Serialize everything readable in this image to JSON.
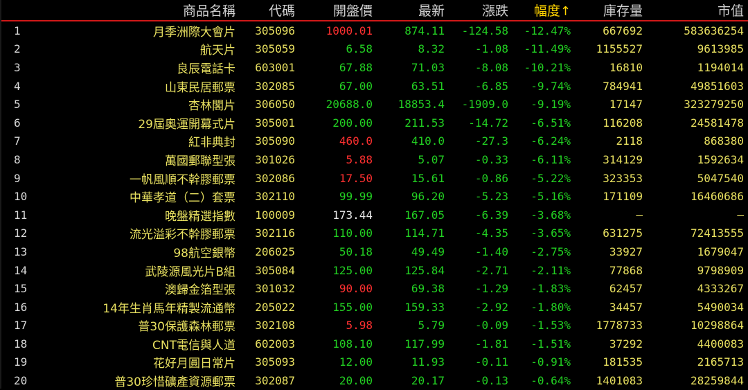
{
  "columns": {
    "name": "商品名稱",
    "code": "代碼",
    "open": "開盤價",
    "last": "最新",
    "change": "漲跌",
    "pct": "幅度",
    "stock": "庫存量",
    "cap": "市值"
  },
  "sort_arrow": "↑",
  "colors": {
    "up": "#ff3030",
    "down": "#22d022",
    "flat": "#e8e8e8",
    "label": "#e8e060",
    "header_line": "#d01818"
  },
  "rows": [
    {
      "idx": "1",
      "name": "月季洲際大會片",
      "code": "305096",
      "open": "1000.01",
      "open_color": "red",
      "last": "874.11",
      "change": "-124.58",
      "pct": "-12.47%",
      "stock": "667692",
      "cap": "583636254"
    },
    {
      "idx": "2",
      "name": "航天片",
      "code": "305059",
      "open": "6.58",
      "open_color": "green",
      "last": "8.32",
      "change": "-1.08",
      "pct": "-11.49%",
      "stock": "1155527",
      "cap": "9613985"
    },
    {
      "idx": "3",
      "name": "良辰電話卡",
      "code": "603001",
      "open": "67.88",
      "open_color": "green",
      "last": "71.03",
      "change": "-8.08",
      "pct": "-10.21%",
      "stock": "16810",
      "cap": "1194014"
    },
    {
      "idx": "4",
      "name": "山東民居郵票",
      "code": "302085",
      "open": "67.00",
      "open_color": "green",
      "last": "63.51",
      "change": "-6.85",
      "pct": "-9.74%",
      "stock": "784941",
      "cap": "49851603"
    },
    {
      "idx": "5",
      "name": "杏林閣片",
      "code": "306050",
      "open": "20688.0",
      "open_color": "green",
      "last": "18853.4",
      "change": "-1909.0",
      "pct": "-9.19%",
      "stock": "17147",
      "cap": "323279250"
    },
    {
      "idx": "6",
      "name": "29屆奧運開幕式片",
      "code": "305001",
      "open": "200.00",
      "open_color": "green",
      "last": "211.53",
      "change": "-14.72",
      "pct": "-6.51%",
      "stock": "116208",
      "cap": "24581478"
    },
    {
      "idx": "7",
      "name": "紅非典封",
      "code": "305090",
      "open": "460.0",
      "open_color": "red",
      "last": "410.0",
      "change": "-27.3",
      "pct": "-6.24%",
      "stock": "2118",
      "cap": "868380"
    },
    {
      "idx": "8",
      "name": "萬國郵聯型張",
      "code": "301026",
      "open": "5.88",
      "open_color": "red",
      "last": "5.07",
      "change": "-0.33",
      "pct": "-6.11%",
      "stock": "314129",
      "cap": "1592634"
    },
    {
      "idx": "9",
      "name": "一帆風順不幹膠郵票",
      "code": "302086",
      "open": "17.50",
      "open_color": "red",
      "last": "15.61",
      "change": "-0.86",
      "pct": "-5.22%",
      "stock": "323353",
      "cap": "5047540"
    },
    {
      "idx": "10",
      "name": "中華孝道（二）套票",
      "code": "302110",
      "open": "99.99",
      "open_color": "green",
      "last": "96.20",
      "change": "-5.23",
      "pct": "-5.16%",
      "stock": "171109",
      "cap": "16460686"
    },
    {
      "idx": "11",
      "name": "晚盤精選指數",
      "code": "100009",
      "open": "173.44",
      "open_color": "white",
      "last": "167.05",
      "change": "-6.39",
      "pct": "-3.68%",
      "stock": "—",
      "cap": "—"
    },
    {
      "idx": "12",
      "name": "流光溢彩不幹膠郵票",
      "code": "302116",
      "open": "110.00",
      "open_color": "green",
      "last": "114.71",
      "change": "-4.35",
      "pct": "-3.65%",
      "stock": "631275",
      "cap": "72413555"
    },
    {
      "idx": "13",
      "name": "98航空銀幣",
      "code": "206025",
      "open": "50.18",
      "open_color": "green",
      "last": "49.49",
      "change": "-1.40",
      "pct": "-2.75%",
      "stock": "33927",
      "cap": "1679047"
    },
    {
      "idx": "14",
      "name": "武陵源風光片B組",
      "code": "305084",
      "open": "125.00",
      "open_color": "green",
      "last": "125.84",
      "change": "-2.71",
      "pct": "-2.11%",
      "stock": "77868",
      "cap": "9798909"
    },
    {
      "idx": "15",
      "name": "澳歸金箔型張",
      "code": "301032",
      "open": "90.00",
      "open_color": "red",
      "last": "69.38",
      "change": "-1.29",
      "pct": "-1.83%",
      "stock": "62457",
      "cap": "4333267"
    },
    {
      "idx": "16",
      "name": "14年生肖馬年精製流通幣",
      "code": "205022",
      "open": "155.00",
      "open_color": "green",
      "last": "159.33",
      "change": "-2.92",
      "pct": "-1.80%",
      "stock": "34457",
      "cap": "5490034"
    },
    {
      "idx": "17",
      "name": "普30保護森林郵票",
      "code": "302108",
      "open": "5.98",
      "open_color": "red",
      "last": "5.79",
      "change": "-0.09",
      "pct": "-1.53%",
      "stock": "1778733",
      "cap": "10298864"
    },
    {
      "idx": "18",
      "name": "CNT電信與人道",
      "code": "602003",
      "open": "108.10",
      "open_color": "green",
      "last": "117.99",
      "change": "-1.81",
      "pct": "-1.51%",
      "stock": "37292",
      "cap": "4400083"
    },
    {
      "idx": "19",
      "name": "花好月圓日常片",
      "code": "305093",
      "open": "12.00",
      "open_color": "green",
      "last": "11.93",
      "change": "-0.11",
      "pct": "-0.91%",
      "stock": "181535",
      "cap": "2165713"
    },
    {
      "idx": "20",
      "name": "普30珍惜礦產資源郵票",
      "code": "302087",
      "open": "20.00",
      "open_color": "green",
      "last": "20.17",
      "change": "-0.13",
      "pct": "-0.64%",
      "stock": "1401083",
      "cap": "28259844"
    }
  ]
}
